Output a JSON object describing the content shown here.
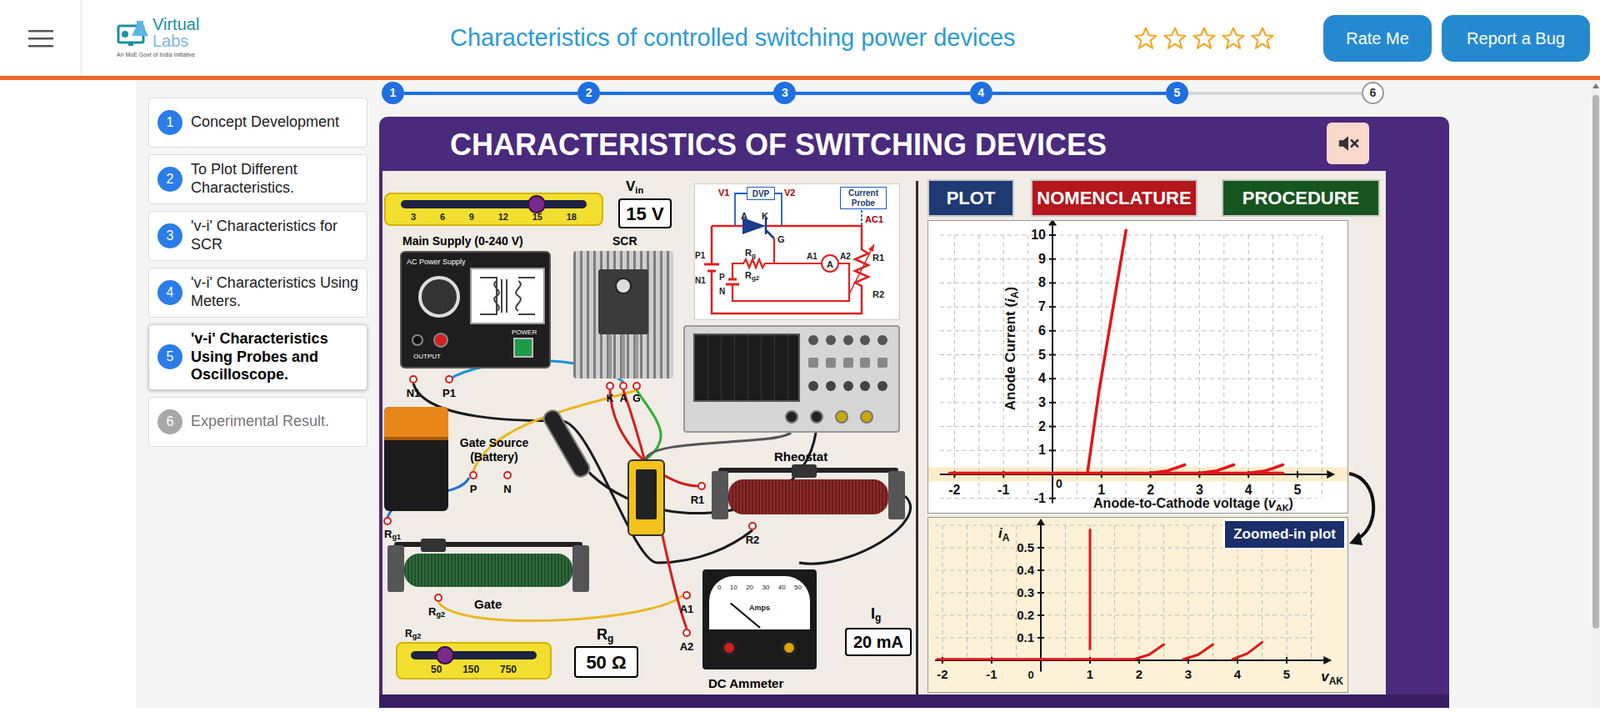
{
  "header": {
    "logo": {
      "name": "Virtual",
      "suffix": "Labs",
      "tagline": "An MoE Govt of India Initiative"
    },
    "title": "Characteristics of controlled switching power devices",
    "rating": {
      "stars": 0,
      "count": 5
    },
    "buttons": [
      {
        "label": "Rate Me"
      },
      {
        "label": "Report a Bug"
      }
    ]
  },
  "stepper": {
    "steps": [
      {
        "label": "1",
        "done": true
      },
      {
        "label": "2",
        "done": true
      },
      {
        "label": "3",
        "done": true
      },
      {
        "label": "4",
        "done": true
      },
      {
        "label": "5",
        "done": true
      },
      {
        "label": "6",
        "done": false
      }
    ]
  },
  "sidebar": {
    "items": [
      {
        "number": "1",
        "label": "Concept Development",
        "selected": false,
        "enabled": true
      },
      {
        "number": "2",
        "label": "To Plot Different Characteristics.",
        "selected": false,
        "enabled": true
      },
      {
        "number": "3",
        "label": "'v-i' Characteristics for SCR",
        "selected": false,
        "enabled": true
      },
      {
        "number": "4",
        "label": "'v-i' Characteristics Using Meters.",
        "selected": false,
        "enabled": true
      },
      {
        "number": "5",
        "label": "'v-i' Characteristics Using Probes and Oscilloscope.",
        "selected": true,
        "enabled": true
      },
      {
        "number": "6",
        "label": "Experimental Result.",
        "selected": false,
        "enabled": false
      }
    ]
  },
  "panel": {
    "title": "CHARACTERISTICS OF SWITCHING DEVICES",
    "muted": true,
    "tabs": [
      {
        "label": "PLOT",
        "color": "#1f3a72"
      },
      {
        "label": "NOMENCLATURE",
        "color": "#b3171d"
      },
      {
        "label": "PROCEDURE",
        "color": "#16551f"
      }
    ]
  },
  "simulation": {
    "vin": {
      "label": "V",
      "sub": "in",
      "value": "15 V",
      "level": 0.73,
      "ticks": [
        "3",
        "6",
        "9",
        "12",
        "15",
        "18"
      ]
    },
    "supply": {
      "label": "Main Supply (0-240 V)",
      "device": "AC Power Supply",
      "output": "OUTPUT",
      "power": "POWER"
    },
    "scr": {
      "label": "SCR",
      "pins": [
        "K",
        "A",
        "G"
      ]
    },
    "battery": {
      "label": "Gate Source (Battery)"
    },
    "rheostat": {
      "label": "Rheostat"
    },
    "gate_rheostat": {
      "label": "Gate"
    },
    "rg": {
      "label": "R",
      "sub": "g",
      "value": "50 Ω",
      "slider_label": "R",
      "slider_sub": "g2",
      "level": 0.27,
      "ticks": [
        "50",
        "150",
        "750"
      ]
    },
    "ig": {
      "label": "I",
      "sub": "g",
      "value": "20 mA"
    },
    "ammeter": {
      "label": "DC Ammeter",
      "unit": "Amps",
      "scale": [
        "0",
        "10",
        "20",
        "30",
        "40",
        "50"
      ]
    },
    "terminals": [
      {
        "label": "N1"
      },
      {
        "label": "P1"
      },
      {
        "label": "P"
      },
      {
        "label": "N"
      },
      {
        "label": "R",
        "sub": "g1"
      },
      {
        "label": "R",
        "sub": "g2"
      },
      {
        "label": "R1"
      },
      {
        "label": "R2"
      },
      {
        "label": "A1"
      },
      {
        "label": "A2"
      }
    ]
  },
  "schematic": {
    "labels": [
      {
        "text": "V1"
      },
      {
        "text": "DVP"
      },
      {
        "text": "V2"
      },
      {
        "text": "Current Probe"
      },
      {
        "text": "A"
      },
      {
        "text": "K"
      },
      {
        "text": "G"
      },
      {
        "text": "AC1"
      },
      {
        "text": "P1"
      },
      {
        "text": "N1"
      },
      {
        "text": "R",
        "sub": "g"
      },
      {
        "text": "R",
        "sub": "g2"
      },
      {
        "text": "A1"
      },
      {
        "text": "A2"
      },
      {
        "text": "A"
      },
      {
        "text": "P"
      },
      {
        "text": "N"
      },
      {
        "text": "R1"
      },
      {
        "text": "R2"
      }
    ]
  },
  "plot": {
    "y_label": {
      "text": "Anode Current (",
      "var": "i",
      "sub": "A",
      "end": ")"
    },
    "x_label": {
      "text": "Anode-to-Cathode voltage (",
      "var": "v",
      "sub": "AK",
      "end": ")"
    },
    "x_ticks": [
      "-2",
      "-1",
      "1",
      "2",
      "3",
      "4",
      "5"
    ],
    "origin": "0",
    "y_ticks": [
      "1",
      "2",
      "3",
      "4",
      "5",
      "6",
      "7",
      "8",
      "9",
      "10",
      "-1"
    ],
    "series": [
      {
        "x": [
          -2.1,
          4.7
        ],
        "y": [
          0.05,
          0.05
        ]
      },
      {
        "x": [
          0.72,
          0.95,
          1.5
        ],
        "y": [
          0.15,
          3.5,
          10.2
        ]
      },
      {
        "x": [
          2.0,
          2.35,
          2.7
        ],
        "y": [
          0.05,
          0.15,
          0.4
        ]
      },
      {
        "x": [
          3.0,
          3.35,
          3.7
        ],
        "y": [
          0.05,
          0.15,
          0.4
        ]
      },
      {
        "x": [
          4.0,
          4.35,
          4.7
        ],
        "y": [
          0.05,
          0.15,
          0.4
        ]
      }
    ]
  },
  "zoom": {
    "badge": "Zoomed-in plot",
    "y_label": {
      "var": "i",
      "sub": "A"
    },
    "x_label": {
      "var": "v",
      "sub": "AK"
    },
    "x_ticks": [
      "-2",
      "-1",
      "1",
      "2",
      "3",
      "4",
      "5"
    ],
    "origin": "0",
    "y_ticks": [
      "0.1",
      "0.2",
      "0.3",
      "0.4",
      "0.5"
    ],
    "series": [
      {
        "x": [
          -2.1,
          1.9
        ],
        "y": [
          0.005,
          0.005
        ]
      },
      {
        "x": [
          1.0,
          1.0
        ],
        "y": [
          0.05,
          0.58
        ]
      },
      {
        "x": [
          1.9,
          2.2,
          2.5
        ],
        "y": [
          0.005,
          0.025,
          0.07
        ]
      },
      {
        "x": [
          2.9,
          3.2,
          3.5
        ],
        "y": [
          0.005,
          0.025,
          0.07
        ]
      },
      {
        "x": [
          3.9,
          4.2,
          4.5
        ],
        "y": [
          0.005,
          0.03,
          0.08
        ]
      }
    ]
  }
}
